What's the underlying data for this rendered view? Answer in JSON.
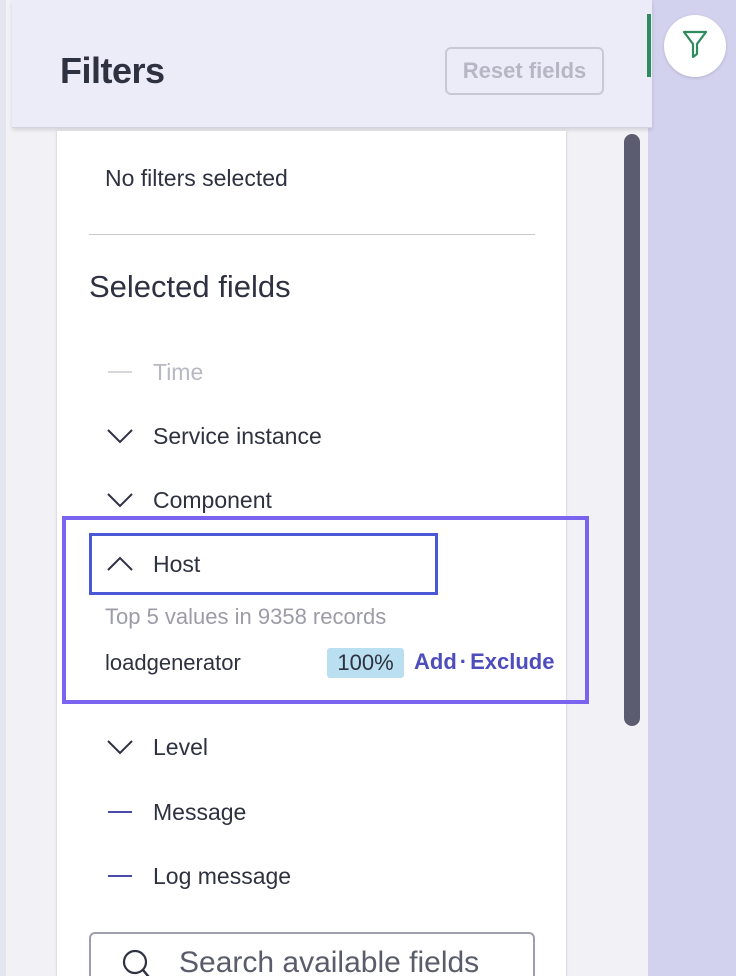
{
  "panel": {
    "title": "Filters",
    "reset_label": "Reset fields"
  },
  "filters": {
    "empty_text": "No filters selected"
  },
  "selected_fields": {
    "title": "Selected fields",
    "fields": [
      {
        "label": "Time",
        "state": "disabled",
        "icon": "dash-icon"
      },
      {
        "label": "Service instance",
        "state": "collapsed",
        "icon": "chevron-down-icon"
      },
      {
        "label": "Component",
        "state": "collapsed",
        "icon": "chevron-down-icon"
      },
      {
        "label": "Host",
        "state": "expanded",
        "icon": "chevron-up-icon"
      },
      {
        "label": "Level",
        "state": "collapsed",
        "icon": "chevron-down-icon"
      },
      {
        "label": "Message",
        "state": "static",
        "icon": "dash-icon"
      },
      {
        "label": "Log message",
        "state": "static",
        "icon": "dash-icon"
      }
    ]
  },
  "host_details": {
    "summary": "Top 5 values in 9358 records",
    "values": [
      {
        "name": "loadgenerator",
        "percent": "100%",
        "add_label": "Add",
        "separator": "·",
        "exclude_label": "Exclude"
      }
    ]
  },
  "search": {
    "placeholder": "Search available fields"
  },
  "colors": {
    "accent": "#4d4dbd",
    "highlight": "#7a63ee",
    "badge": "#b9dff0",
    "fab_icon": "#2e8b5e"
  }
}
